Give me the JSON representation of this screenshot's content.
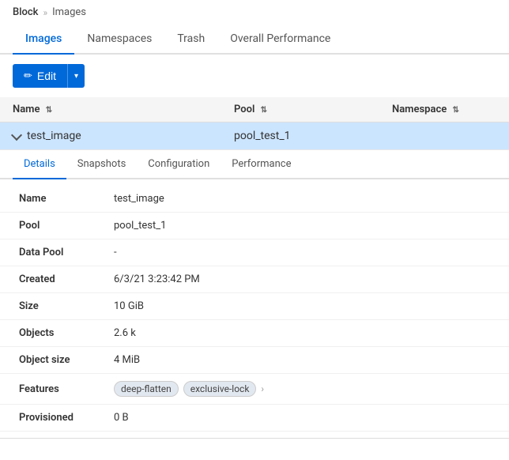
{
  "breadcrumb": {
    "parent": "Block",
    "separator": "»",
    "current": "Images"
  },
  "main_tabs": [
    {
      "id": "images",
      "label": "Images",
      "active": true
    },
    {
      "id": "namespaces",
      "label": "Namespaces",
      "active": false
    },
    {
      "id": "trash",
      "label": "Trash",
      "active": false
    },
    {
      "id": "overall-performance",
      "label": "Overall Performance",
      "active": false
    }
  ],
  "toolbar": {
    "edit_label": "Edit",
    "edit_icon": "✏"
  },
  "table": {
    "columns": [
      {
        "id": "name",
        "label": "Name",
        "sortable": true
      },
      {
        "id": "pool",
        "label": "Pool",
        "sortable": true
      },
      {
        "id": "namespace",
        "label": "Namespace",
        "sortable": true
      }
    ],
    "rows": [
      {
        "name": "test_image",
        "pool": "pool_test_1",
        "namespace": "",
        "selected": true,
        "expanded": true
      }
    ]
  },
  "detail": {
    "tabs": [
      {
        "id": "details",
        "label": "Details",
        "active": true
      },
      {
        "id": "snapshots",
        "label": "Snapshots",
        "active": false
      },
      {
        "id": "configuration",
        "label": "Configuration",
        "active": false
      },
      {
        "id": "performance",
        "label": "Performance",
        "active": false
      }
    ],
    "fields": [
      {
        "label": "Name",
        "value": "test_image",
        "type": "text"
      },
      {
        "label": "Pool",
        "value": "pool_test_1",
        "type": "text"
      },
      {
        "label": "Data Pool",
        "value": "-",
        "type": "text"
      },
      {
        "label": "Created",
        "value": "6/3/21 3:23:42 PM",
        "type": "text"
      },
      {
        "label": "Size",
        "value": "10 GiB",
        "type": "text"
      },
      {
        "label": "Objects",
        "value": "2.6 k",
        "type": "text"
      },
      {
        "label": "Object size",
        "value": "4 MiB",
        "type": "text"
      },
      {
        "label": "Features",
        "value": "",
        "type": "badges",
        "badges": [
          "deep-flatten",
          "exclusive-lock"
        ]
      },
      {
        "label": "Provisioned",
        "value": "0 B",
        "type": "text"
      }
    ]
  }
}
